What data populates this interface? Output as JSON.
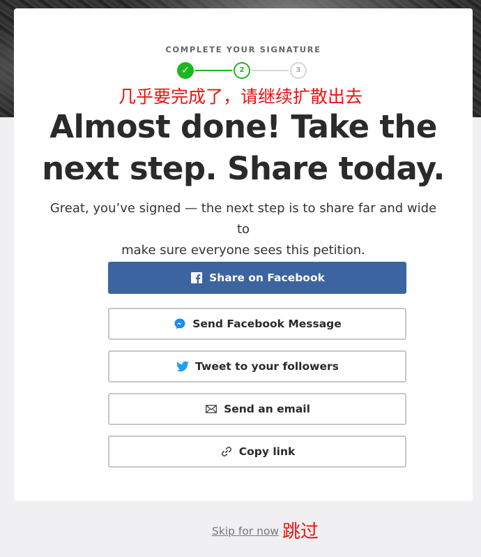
{
  "eyebrow": "COMPLETE YOUR SIGNATURE",
  "stepper": {
    "step1_symbol": "✓",
    "step2_label": "2",
    "step3_label": "3",
    "current_step": 2,
    "total_steps": 3,
    "completed_color": "#1db81d",
    "pending_color": "#d6d6d6"
  },
  "annotations": {
    "top": "几乎要完成了，请继续扩散出去",
    "skip": "跳过",
    "color": "#ee1111"
  },
  "headline": {
    "line1": "Almost done! Take the",
    "line2": "next step. Share today."
  },
  "subtext": {
    "line1": "Great, you’ve signed — the next step is to share far and wide to",
    "line2": "make sure everyone sees this petition."
  },
  "buttons": {
    "facebook": {
      "label": "Share on Facebook",
      "icon": "facebook-icon",
      "color": "#3b64a0"
    },
    "messenger": {
      "label": "Send Facebook Message",
      "icon": "messenger-icon"
    },
    "twitter": {
      "label": "Tweet to your followers",
      "icon": "twitter-icon"
    },
    "email": {
      "label": "Send an email",
      "icon": "envelope-icon"
    },
    "copy_link": {
      "label": "Copy link",
      "icon": "link-icon"
    }
  },
  "skip": {
    "label": "Skip for now"
  }
}
